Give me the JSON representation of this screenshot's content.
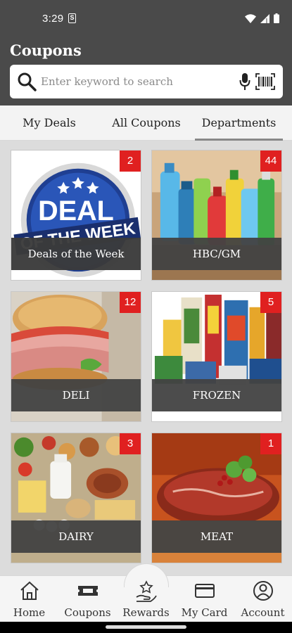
{
  "status_bar": {
    "time": "3:29",
    "indicator": "S"
  },
  "header": {
    "title": "Coupons"
  },
  "search": {
    "placeholder": "Enter keyword to search"
  },
  "tabs": [
    {
      "label": "My Deals",
      "active": false
    },
    {
      "label": "All Coupons",
      "active": false
    },
    {
      "label": "Departments",
      "active": true
    }
  ],
  "departments": [
    {
      "label": "",
      "count": "2",
      "image_text_line1": "DEAL",
      "image_text_line2": "OF THE WEEK",
      "overlay_label": "Deals of the Week"
    },
    {
      "label": "HBC/GM",
      "count": "44"
    },
    {
      "label": "DELI",
      "count": "12"
    },
    {
      "label": "FROZEN",
      "count": "5"
    },
    {
      "label": "DAIRY",
      "count": "3"
    },
    {
      "label": "MEAT",
      "count": "1"
    }
  ],
  "bottom_nav": [
    {
      "label": "Home",
      "icon": "home-icon"
    },
    {
      "label": "Coupons",
      "icon": "coupon-icon"
    },
    {
      "label": "Rewards",
      "icon": "rewards-icon"
    },
    {
      "label": "My Card",
      "icon": "card-icon"
    },
    {
      "label": "Account",
      "icon": "account-icon"
    }
  ],
  "colors": {
    "header_bg": "#4a4a4a",
    "badge": "#e02020",
    "label_bg": "#424242",
    "content_bg": "#dcdcdc"
  }
}
